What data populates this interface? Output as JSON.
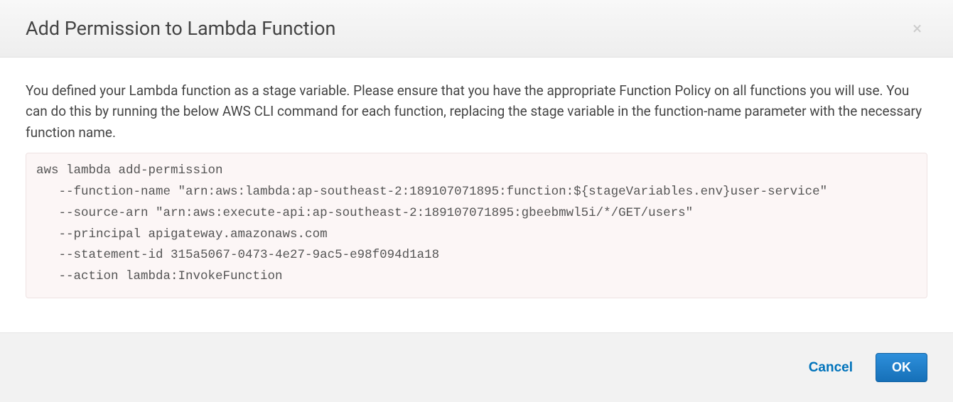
{
  "header": {
    "title": "Add Permission to Lambda Function"
  },
  "body": {
    "description": "You defined your Lambda function as a stage variable. Please ensure that you have the appropriate Function Policy on all functions you will use. You can do this by running the below AWS CLI command for each function, replacing the stage variable in the function-name parameter with the necessary function name.",
    "code": "aws lambda add-permission \n   --function-name \"arn:aws:lambda:ap-southeast-2:189107071895:function:${stageVariables.env}user-service\" \n   --source-arn \"arn:aws:execute-api:ap-southeast-2:189107071895:gbeebmwl5i/*/GET/users\" \n   --principal apigateway.amazonaws.com \n   --statement-id 315a5067-0473-4e27-9ac5-e98f094d1a18 \n   --action lambda:InvokeFunction"
  },
  "footer": {
    "cancel_label": "Cancel",
    "ok_label": "OK"
  }
}
